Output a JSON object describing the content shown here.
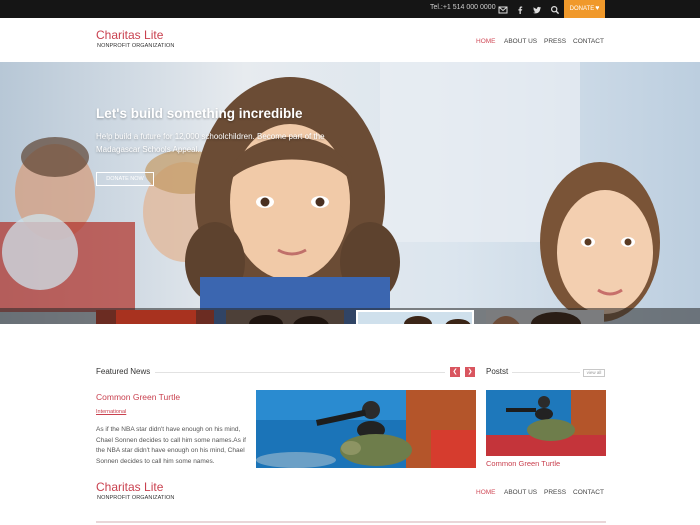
{
  "topbar": {
    "phone": "Tel.:+1 514 000 0000",
    "icons": [
      "mail-icon",
      "facebook-icon",
      "twitter-icon",
      "search-icon"
    ],
    "donate_label": "DONATE"
  },
  "header": {
    "logo_title": "Charitas Lite",
    "logo_subtitle": "NONPROFIT ORGANIZATION",
    "nav": [
      {
        "label": "HOME",
        "active": true
      },
      {
        "label": "ABOUT US",
        "active": false
      },
      {
        "label": "PRESS",
        "active": false
      },
      {
        "label": "CONTACT",
        "active": false
      }
    ]
  },
  "hero": {
    "title": "Let's build something incredible",
    "text": "Help build a future for 12,000 schoolchildren. Become part of the Madagascar Schools Appeal.",
    "button_label": "DONATE NOW",
    "thumbnails": [
      "slide-thumb-1",
      "slide-thumb-2",
      "slide-thumb-3",
      "slide-thumb-4"
    ],
    "active_thumbnail": 2
  },
  "featured": {
    "title": "Featured News",
    "post_title": "Common Green Turtle",
    "category": "International",
    "body": "As if the NBA star didn't have enough on his mind, Chael Sonnen decides to call him some names.As if the NBA star didn't have enough on his mind, Chael Sonnen decides to call him some names."
  },
  "posts": {
    "title": "Postst",
    "view_all": "view all",
    "item_title": "Common Green Turtle"
  },
  "footer_header": {
    "logo_title": "Charitas Lite",
    "logo_subtitle": "NONPROFIT ORGANIZATION",
    "nav": [
      {
        "label": "HOME",
        "active": true
      },
      {
        "label": "ABOUT US",
        "active": false
      },
      {
        "label": "PRESS",
        "active": false
      },
      {
        "label": "CONTACT",
        "active": false
      }
    ]
  },
  "colors": {
    "accent": "#c9414f",
    "donate": "#f0992b",
    "topbar": "#151515"
  }
}
